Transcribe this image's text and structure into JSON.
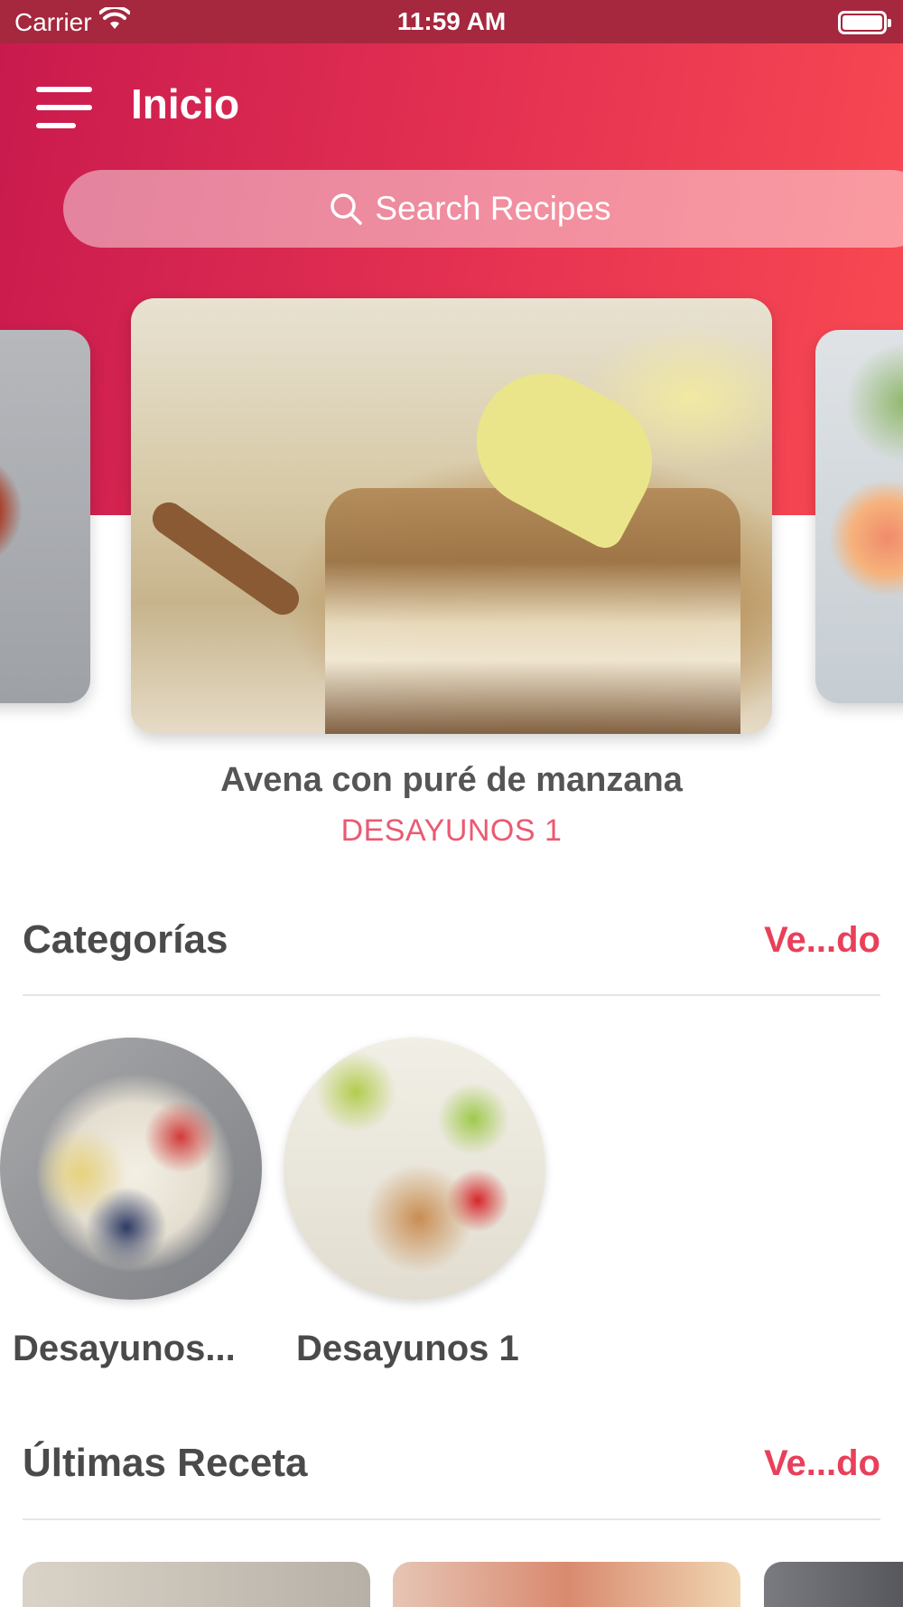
{
  "status_bar": {
    "carrier": "Carrier",
    "time": "11:59 AM",
    "wifi_icon": "wifi-icon",
    "battery_icon": "battery-icon"
  },
  "header": {
    "title": "Inicio",
    "menu_icon": "hamburger-menu-icon",
    "gradient_colors": [
      "#c91a4e",
      "#e63352",
      "#f94a52"
    ]
  },
  "search": {
    "placeholder": "Search Recipes",
    "icon": "search-icon"
  },
  "featured": {
    "title": "Avena con puré de manzana",
    "category": "DESAYUNOS 1"
  },
  "categories_section": {
    "title": "Categorías",
    "see_all": "Ve...do",
    "items": [
      {
        "label": "Desayunos..."
      },
      {
        "label": "Desayunos 1"
      }
    ]
  },
  "latest_section": {
    "title": "Últimas Receta",
    "see_all": "Ve...do"
  },
  "colors": {
    "accent": "#e8405a",
    "category_text": "#ea5a72",
    "status_bar": "#a5283e"
  }
}
